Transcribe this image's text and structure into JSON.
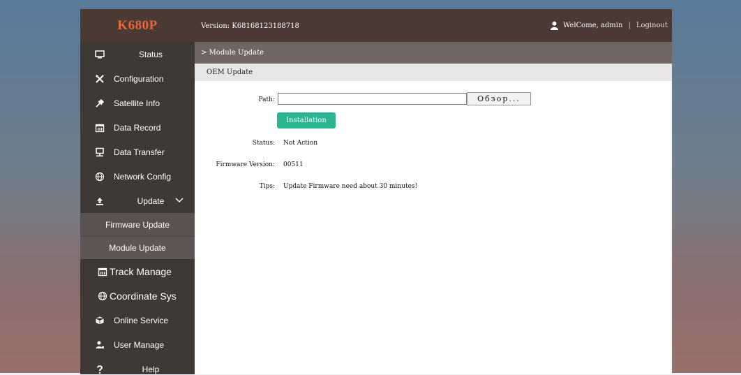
{
  "app": {
    "logo": "K680P"
  },
  "header": {
    "version_text": "Version: K68168123188718",
    "welcome_text": "WelCome, admin",
    "separator": "|",
    "logout_label": "Loginout"
  },
  "sidebar": {
    "items": [
      {
        "label": "Status",
        "icon": "monitor-icon"
      },
      {
        "label": "Configuration",
        "icon": "tools-icon"
      },
      {
        "label": "Satellite Info",
        "icon": "satellite-icon"
      },
      {
        "label": "Data Record",
        "icon": "calendar-icon"
      },
      {
        "label": "Data Transfer",
        "icon": "transfer-icon"
      },
      {
        "label": "Network Config",
        "icon": "globe-icon"
      },
      {
        "label": "Update",
        "icon": "upload-icon"
      }
    ],
    "update_sub": [
      {
        "label": "Firmware Update"
      },
      {
        "label": "Module Update"
      }
    ],
    "items2": [
      {
        "label": "Track Manage",
        "icon": "calendar-icon"
      },
      {
        "label": "Coordinate Sys",
        "icon": "globe-icon"
      },
      {
        "label": "Online Service",
        "icon": "service-icon"
      },
      {
        "label": "User Manage",
        "icon": "user-manage-icon"
      },
      {
        "label": "Help",
        "icon": "help-icon"
      }
    ]
  },
  "breadcrumb": {
    "text": "> Module Update"
  },
  "section": {
    "title": "OEM Update"
  },
  "form": {
    "path_label": "Path:",
    "path_value": "",
    "browse_label": "Обзор...",
    "install_label": "Installation",
    "status_label": "Status:",
    "status_value": "Not Action",
    "firmware_label": "Firmware Version:",
    "firmware_value": "00511",
    "tips_label": "Tips:",
    "tips_value": "Update Firmware need about 30 minutes!"
  },
  "colors": {
    "header_bg": "#4a3a33",
    "sidebar_bg": "#3f3936",
    "logo": "#e8673a",
    "install_button": "#2bb693"
  }
}
